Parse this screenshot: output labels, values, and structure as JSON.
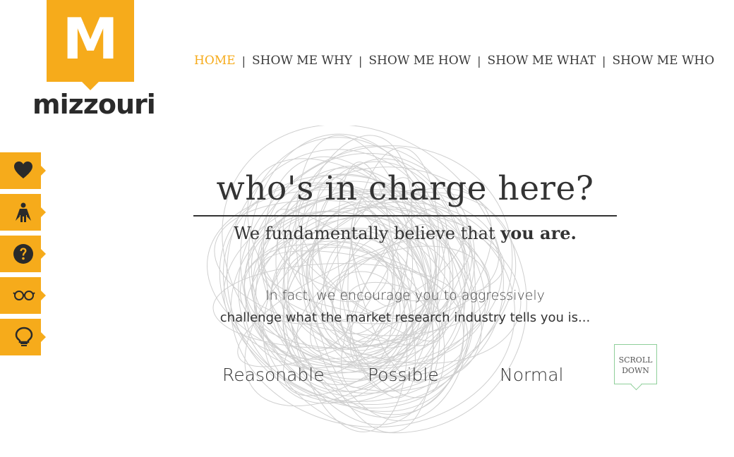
{
  "brand": {
    "letter": "M",
    "name": "mizzouri",
    "reg": "®",
    "color": "#f6ab1b"
  },
  "nav": {
    "items": [
      {
        "label": "HOME",
        "active": true
      },
      {
        "label": "SHOW ME WHY"
      },
      {
        "label": "SHOW ME HOW"
      },
      {
        "label": "SHOW ME WHAT"
      },
      {
        "label": "SHOW ME WHO"
      }
    ],
    "separator": "|"
  },
  "side_tabs": [
    {
      "icon": "heart-icon"
    },
    {
      "icon": "superhero-icon"
    },
    {
      "icon": "question-icon"
    },
    {
      "icon": "glasses-icon"
    },
    {
      "icon": "lightbulb-icon"
    }
  ],
  "hero": {
    "headline": "who's in charge here?",
    "belief_prefix": "We fundamentally believe that ",
    "belief_bold": "you are.",
    "para1": "In fact, we encourage you to aggressively",
    "para2": "challenge what the market research industry tells you is...",
    "words": [
      "Reasonable",
      "Possible",
      "Normal"
    ]
  },
  "scroll": {
    "line1": "SCROLL",
    "line2": "DOWN"
  }
}
